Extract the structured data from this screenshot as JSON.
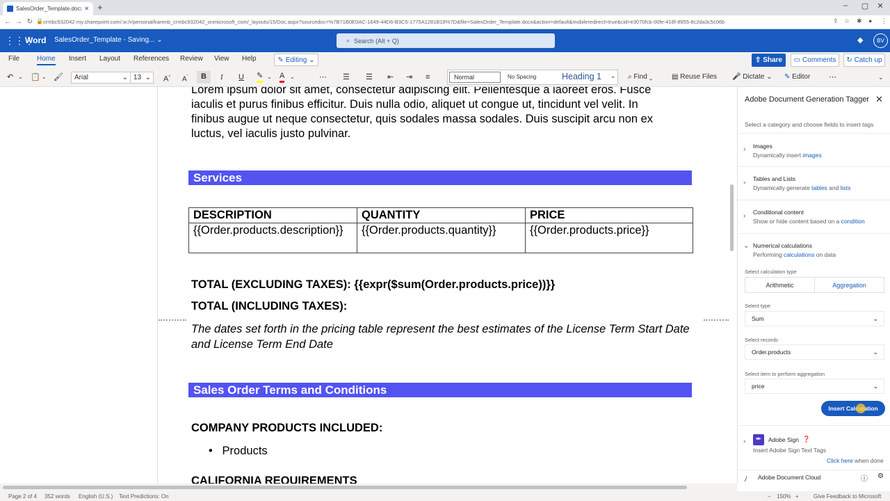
{
  "browser": {
    "tab_title": "SalesOrder_Template.docx",
    "url": "crmbc932042-my.sharepoint.com/:w:/r/personal/karenb_crmbc932042_onmicrosoft_com/_layouts/15/Doc.aspx?sourcedoc=%7B71B0E0AC-1649-44D6-B3C5-1775A1281B18%7D&file=SalesOrder_Template.docx&action=default&mobileredirect=true&cid=e3070fcb-00fe-416f-8955-8c2da3c5c06b"
  },
  "appbar": {
    "app_name": "Word",
    "doc_title": "SalesOrder_Template - Saving...",
    "search_placeholder": "Search (Alt + Q)",
    "avatar_initials": "BV"
  },
  "menu": {
    "items": [
      "File",
      "Home",
      "Insert",
      "Layout",
      "References",
      "Review",
      "View",
      "Help"
    ],
    "editing_label": "Editing",
    "share_label": "Share",
    "comments_label": "Comments",
    "catchup_label": "Catch up"
  },
  "ribbon": {
    "font_name": "Arial",
    "font_size": "13",
    "styles": {
      "normal": "Normal",
      "nospacing": "No Spacing",
      "heading1": "Heading 1"
    },
    "find_label": "Find",
    "reuse_label": "Reuse Files",
    "dictate_label": "Dictate",
    "editor_label": "Editor"
  },
  "document": {
    "lorem_line1": "Lorem ipsum dolor sit amet, consectetur adipiscing elit. Pellentesque a laoreet eros. Fusce",
    "lorem_line2": "iaculis et purus finibus efficitur. Duis nulla odio, aliquet ut congue ut, tincidunt vel velit. In",
    "lorem_line3": "finibus augue ut neque consectetur, quis sodales massa sodales. Duis suscipit arcu non ex",
    "lorem_line4": "luctus, vel iaculis justo pulvinar.",
    "services_heading": "Services",
    "table": {
      "headers": [
        "DESCRIPTION",
        "QUANTITY",
        "PRICE"
      ],
      "row": [
        "{{Order.products.description}}",
        "{{Order.products.quantity}}",
        "{{Order.products.price}}"
      ]
    },
    "total_excl": "TOTAL (EXCLUDING TAXES): {{expr($sum(Order.products.price))}}",
    "total_incl": "TOTAL (INCLUDING TAXES):",
    "dates_note": "The dates set forth in the pricing table represent the best estimates of the License Term Start Date and License Term End Date",
    "terms_heading": "Sales Order Terms and Conditions",
    "company_products": "COMPANY PRODUCTS INCLUDED:",
    "bullet": "Products",
    "california": "CALIFORNIA REQUIREMENTS"
  },
  "panel": {
    "title": "Adobe Document Generation Tagger",
    "subtitle": "Select a category and choose fields to insert tags",
    "categories": [
      {
        "title": "Images",
        "desc_pre": "Dynamically insert ",
        "desc_link": "images",
        "desc_post": ""
      },
      {
        "title": "Tables and Lists",
        "desc_pre": "Dynamically generate ",
        "desc_link": "tables",
        "desc_mid": " and ",
        "desc_link2": "lists"
      },
      {
        "title": "Conditional content",
        "desc_pre": "Show or hide content based on a ",
        "desc_link": "condition",
        "desc_post": ""
      },
      {
        "title": "Numerical calculations",
        "desc_pre": "Performing ",
        "desc_link": "calculations",
        "desc_post": " on data"
      }
    ],
    "calc_type_label": "Select calculation type",
    "seg_arithmetic": "Arithmetic",
    "seg_aggregation": "Aggregation",
    "type_label": "Select type",
    "type_value": "Sum",
    "records_label": "Select records",
    "records_value": "Order.products",
    "item_label": "Select item to perform aggregation",
    "item_value": "price",
    "insert_button": "Insert Calculation",
    "adobe_sign_title": "Adobe Sign",
    "adobe_sign_desc": "Insert Adobe Sign Text Tags",
    "click_here": "Click here",
    "when_done": " when done",
    "footer": "Adobe Document Cloud"
  },
  "status": {
    "page": "Page 2 of 4",
    "words": "352 words",
    "lang": "English (U.S.)",
    "predictions": "Text Predictions: On",
    "zoom": "150%",
    "feedback": "Give Feedback to Microsoft"
  }
}
